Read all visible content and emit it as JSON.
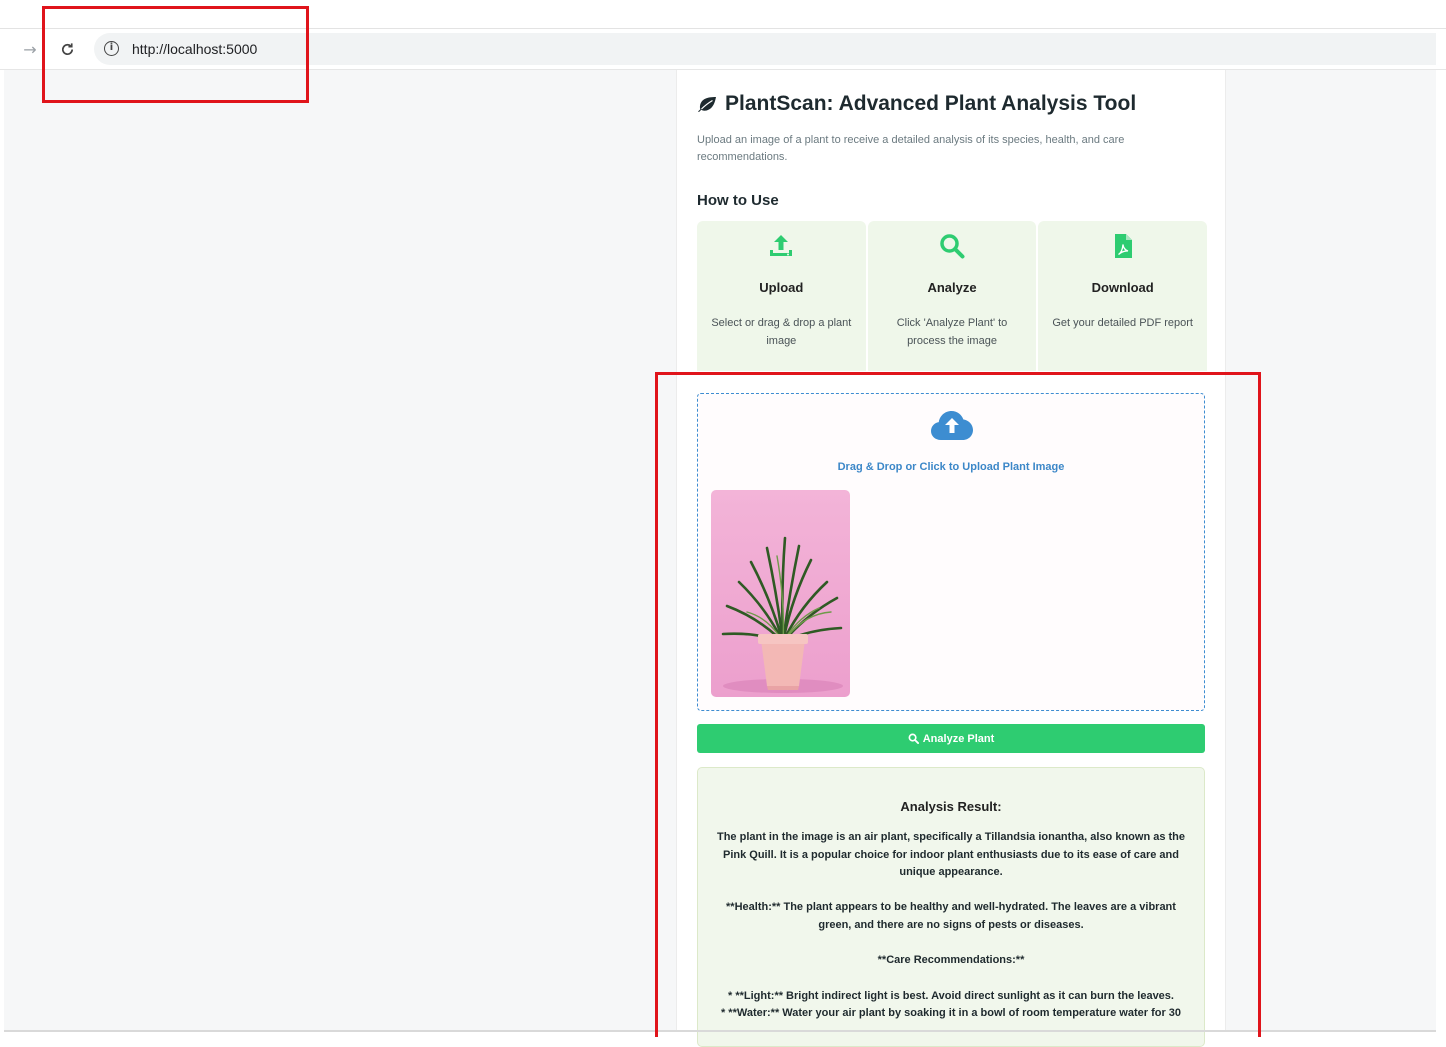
{
  "browser": {
    "url": "http://localhost:5000",
    "forward_icon": "arrow-right-icon",
    "reload_icon": "reload-icon",
    "info_icon": "info-icon",
    "info_glyph": "i"
  },
  "app": {
    "title": "PlantScan: Advanced Plant Analysis Tool",
    "subtitle": "Upload an image of a plant to receive a detailed analysis of its species, health, and care recommendations.",
    "how_to_heading": "How to Use",
    "steps": [
      {
        "icon": "upload-icon",
        "title": "Upload",
        "description": "Select or drag & drop a plant image"
      },
      {
        "icon": "search-icon",
        "title": "Analyze",
        "description": "Click 'Analyze Plant' to process the image"
      },
      {
        "icon": "pdf-file-icon",
        "title": "Download",
        "description": "Get your detailed PDF report"
      }
    ],
    "dropzone_label": "Drag & Drop or Click to Upload Plant Image",
    "analyze_button": "Analyze Plant",
    "result": {
      "heading": "Analysis Result:",
      "paragraphs": [
        "The plant in the image is an air plant, specifically a Tillandsia ionantha, also known as the Pink Quill. It is a popular choice for indoor plant enthusiasts due to its ease of care and unique appearance.",
        "**Health:** The plant appears to be healthy and well-hydrated. The leaves are a vibrant green, and there are no signs of pests or diseases.",
        "**Care Recommendations:**",
        "* **Light:** Bright indirect light is best. Avoid direct sunlight as it can burn the leaves.",
        "* **Water:** Water your air plant by soaking it in a bowl of room temperature water for 30"
      ]
    }
  },
  "colors": {
    "accent_green": "#2ecc71",
    "link_blue": "#3c87c8",
    "annotation_red": "#e0141b"
  }
}
